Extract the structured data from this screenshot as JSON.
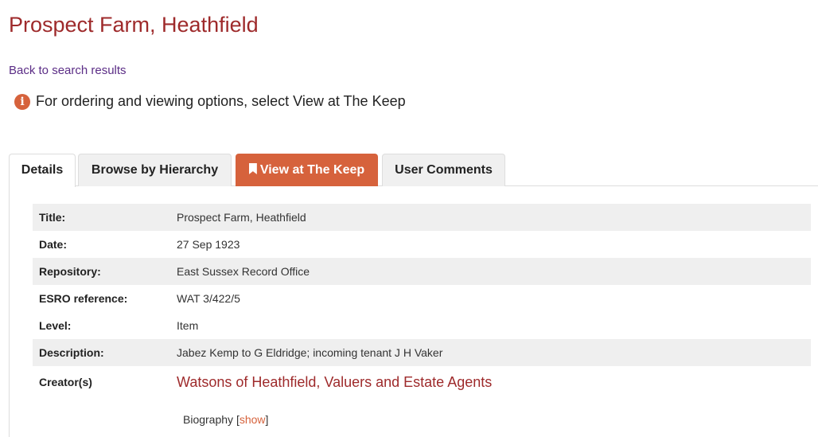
{
  "page": {
    "title": "Prospect Farm, Heathfield",
    "back_link": "Back to search results",
    "notice": "For ordering and viewing options, select View at The Keep",
    "notice_icon": "info-icon"
  },
  "tabs": [
    {
      "label": "Details",
      "active": true
    },
    {
      "label": "Browse by Hierarchy",
      "active": false
    },
    {
      "label": "View at The Keep",
      "active": false,
      "icon": "bookmark-icon",
      "color": "#d6623c"
    },
    {
      "label": "User Comments",
      "active": false
    }
  ],
  "details": [
    {
      "label": "Title:",
      "value": "Prospect Farm, Heathfield"
    },
    {
      "label": "Date:",
      "value": "27 Sep 1923"
    },
    {
      "label": "Repository:",
      "value": "East Sussex Record Office"
    },
    {
      "label": "ESRO reference:",
      "value": "WAT 3/422/5"
    },
    {
      "label": "Level:",
      "value": "Item"
    },
    {
      "label": "Description:",
      "value": "Jabez Kemp to G Eldridge; incoming tenant J H Vaker"
    }
  ],
  "creator": {
    "label": "Creator(s)",
    "name": "Watsons of Heathfield, Valuers and Estate Agents",
    "biography_label": "Biography",
    "bio_open": "[",
    "show_link": "show",
    "bio_close": "]"
  },
  "colors": {
    "title": "#9e2a2b",
    "accent": "#d6623c",
    "link": "#5b2d86"
  }
}
